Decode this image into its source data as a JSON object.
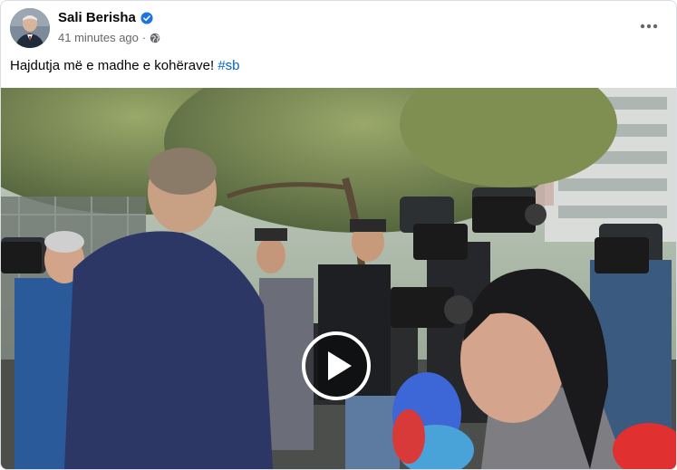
{
  "post": {
    "author": "Sali Berisha",
    "timestamp": "41 minutes ago",
    "separator": "·",
    "caption": "Hajdutja më e madhe e kohërave!",
    "hashtag": "#sb",
    "verified_icon": "verified-badge-icon",
    "audience_icon": "globe-icon",
    "more_icon": "more-options-icon"
  },
  "colors": {
    "hashtag": "#0064d1",
    "verified": "#1b74e4",
    "meta_text": "#65676b"
  }
}
